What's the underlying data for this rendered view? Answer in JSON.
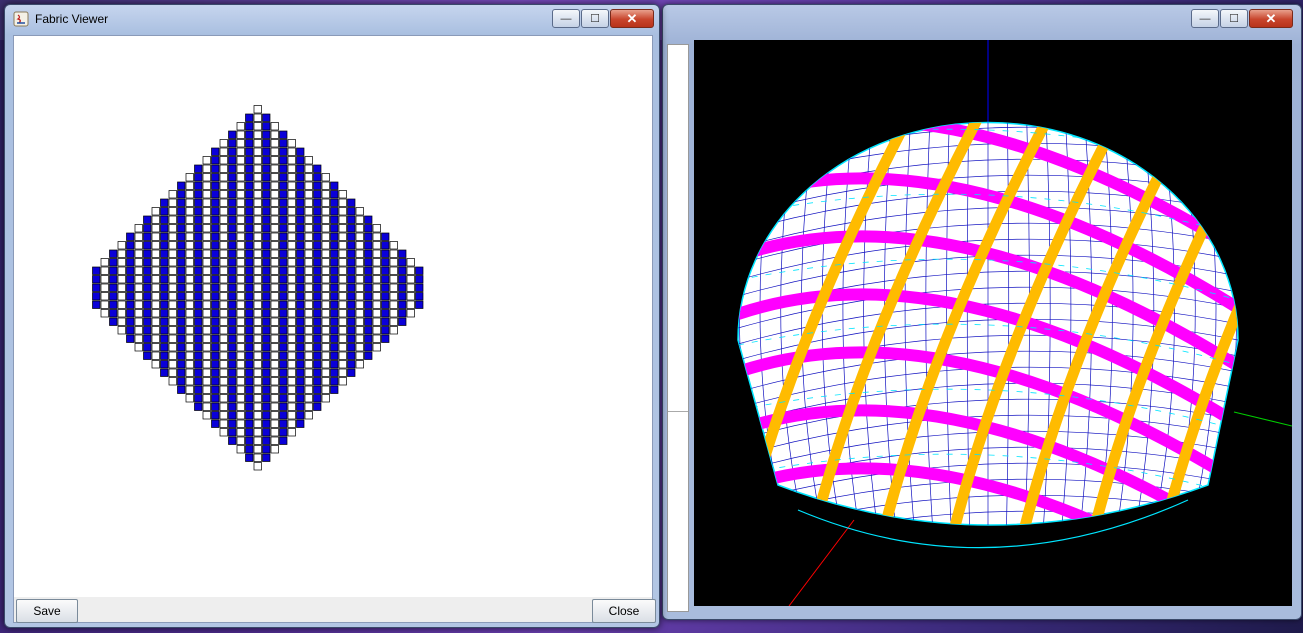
{
  "fabric_viewer": {
    "title": "Fabric Viewer",
    "save_label": "Save",
    "close_label": "Close",
    "fabric_columns": 39,
    "colors": {
      "warp": "#0a00d8",
      "weft": "#ffffff",
      "outline": "#000000"
    }
  },
  "viewer3d": {
    "colors": {
      "background": "#000000",
      "mesh": "#1010c0",
      "highlight": "#00e5ff",
      "band_a": "#ff00ff",
      "band_b": "#ffbb00",
      "axis_x": "#00cc00",
      "axis_y": "#0000ff",
      "axis_z": "#ff0000"
    }
  },
  "window_controls": {
    "minimize": "—",
    "maximize": "☐",
    "close": "✕"
  }
}
